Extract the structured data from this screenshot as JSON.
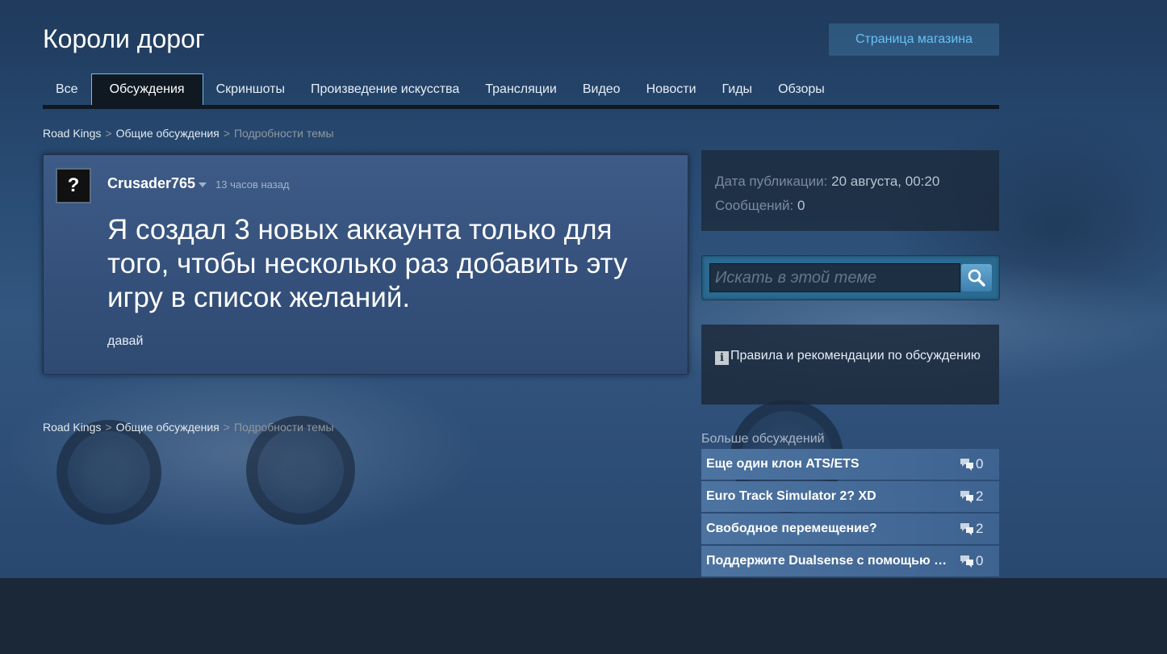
{
  "header": {
    "title": "Короли дорог",
    "store_button": "Страница магазина"
  },
  "tabs": [
    {
      "label": "Все"
    },
    {
      "label": "Обсуждения"
    },
    {
      "label": "Скриншоты"
    },
    {
      "label": "Произведение искусства"
    },
    {
      "label": "Трансляции"
    },
    {
      "label": "Видео"
    },
    {
      "label": "Новости"
    },
    {
      "label": "Гиды"
    },
    {
      "label": "Обзоры"
    }
  ],
  "breadcrumb": {
    "game": "Road Kings",
    "forum": "Общие обсуждения",
    "current": "Подробности темы",
    "separator": ">"
  },
  "post": {
    "avatar_placeholder": "?",
    "author": "Crusader765",
    "time": "13 часов назад",
    "title": "Я создал 3 новых аккаунта только для того, чтобы несколько раз добавить эту игру в список желаний.",
    "body": "давай"
  },
  "info": {
    "date_label": "Дата публикации:",
    "date_value": "20 августа, 00:20",
    "messages_label": "Сообщений:",
    "messages_value": "0"
  },
  "search": {
    "placeholder": "Искать в этой теме"
  },
  "rules": {
    "text": "Правила и рекомендации по обсуждению"
  },
  "more": {
    "title": "Больше обсуждений",
    "items": [
      {
        "title": "Еще один клон ATS/ETS",
        "count": "0"
      },
      {
        "title": "Euro Track Simulator 2? XD",
        "count": "2"
      },
      {
        "title": "Свободное перемещение?",
        "count": "2"
      },
      {
        "title": "Поддержите Dualsense с помощью Steam Input",
        "count": "0"
      }
    ]
  },
  "colors": {
    "accent": "#67c1f5",
    "page_bg": "#1b2838",
    "tab_active_bg": "#101822"
  }
}
